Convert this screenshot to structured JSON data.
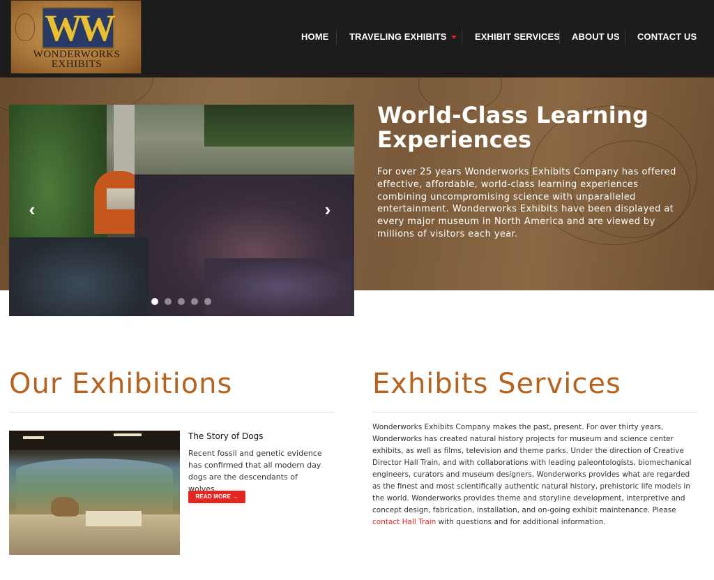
{
  "brand": {
    "logo_mark": "WW",
    "logo_line1": "WONDERWORKS",
    "logo_line2": "EXHIBITS"
  },
  "nav": {
    "home": "HOME",
    "traveling": "TRAVELING EXHIBITS",
    "services": "EXHIBIT SERVICES",
    "about": "ABOUT US",
    "contact": "CONTACT US"
  },
  "hero": {
    "title": "World-Class Learning Experiences",
    "text": "For over 25 years Wonderworks Exhibits Company has offered effective, affordable, world-class learning experiences combining uncompromising science with unparalleled entertainment. Wonderworks Exhibits have been displayed at every major museum in North America and are viewed by millions of visitors each year.",
    "prev_icon": "chevron-left-icon",
    "next_icon": "chevron-right-icon",
    "slide_count": 5,
    "active_slide": 1
  },
  "exhibitions": {
    "heading": "Our Exhibitions",
    "item_title": "The Story of Dogs",
    "item_text": "Recent fossil and genetic evidence has confirmed that all modern day dogs are the descendants of wolves.",
    "read_more": "READ MORE"
  },
  "services": {
    "heading": "Exhibits Services",
    "text_before": "Wonderworks Exhibits Company makes the past, present. For over thirty years, Wonderworks has created natural history projects for museum and science center exhibits, as well as films, television and theme parks. Under the direction of Creative Director Hall Train, and with collaborations with leading paleontologists, biomechanical engineers, curators and museum designers, Wonderworks provides what are regarded as the finest and most scientifically authentic natural history, prehistoric life models in the world. Wonderworks provides theme and storyline development, interpretive and concept design, fabrication, installation, and on-going exhibit maintenance. Please ",
    "link": "contact Hall Train",
    "text_after": " with questions and for additional information."
  },
  "colors": {
    "header_bg": "#1c1c1c",
    "accent_orange": "#b5631f",
    "button_red": "#e3261f"
  }
}
